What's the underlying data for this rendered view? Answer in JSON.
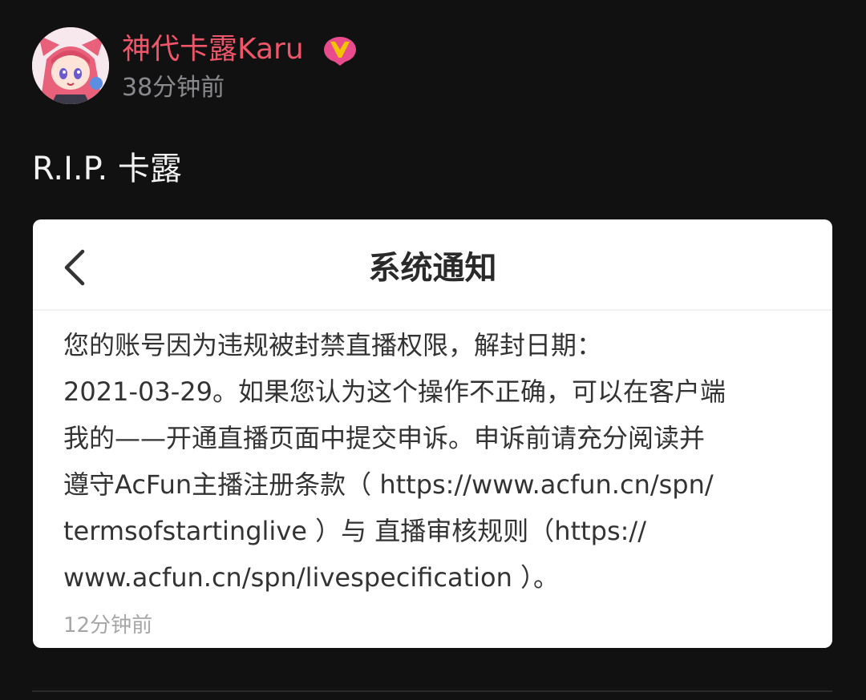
{
  "post": {
    "user_name": "神代卡露Karu",
    "time": "38分钟前",
    "text": "R.I.P. 卡露"
  },
  "notice": {
    "title": "系统通知",
    "body_lines": [
      "您的账号因为违规被封禁直播权限，解封日期：",
      "2021-03-29。如果您认为这个操作不正确，可以在客户端",
      "我的——开通直播页面中提交申诉。申诉前请充分阅读并",
      "遵守AcFun主播注册条款（ https://www.acfun.cn/spn/",
      "termsofstartinglive ）与 直播审核规则（https://",
      "www.acfun.cn/spn/livespecification ）。"
    ],
    "time": "12分钟前"
  },
  "icons": {
    "avatar": "avatar-image",
    "badge": "vip-badge-icon",
    "back": "back-chevron-icon"
  },
  "colors": {
    "background": "#111112",
    "user_name": "#f0566a",
    "badge": "#f5c400",
    "card": "#ffffff"
  }
}
